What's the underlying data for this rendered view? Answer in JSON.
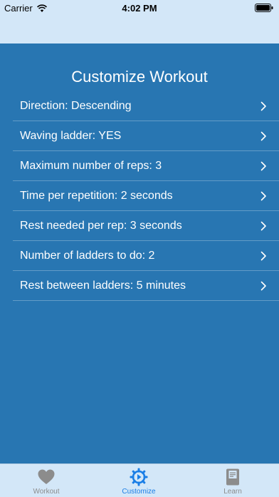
{
  "status_bar": {
    "carrier": "Carrier",
    "time": "4:02 PM"
  },
  "main": {
    "title": "Customize Workout",
    "settings": [
      {
        "label": "Direction: Descending"
      },
      {
        "label": "Waving ladder: YES"
      },
      {
        "label": "Maximum number of reps: 3"
      },
      {
        "label": "Time per repetition: 2 seconds"
      },
      {
        "label": "Rest needed per rep: 3 seconds"
      },
      {
        "label": "Number of ladders to do: 2"
      },
      {
        "label": "Rest between ladders: 5 minutes"
      }
    ]
  },
  "tab_bar": {
    "tabs": [
      {
        "label": "Workout",
        "icon": "heart-icon",
        "active": false
      },
      {
        "label": "Customize",
        "icon": "gear-icon",
        "active": true
      },
      {
        "label": "Learn",
        "icon": "book-icon",
        "active": false
      }
    ]
  },
  "colors": {
    "background": "#d3e7f8",
    "panel": "#2876b2",
    "active_tab": "#1a7ee6",
    "inactive_tab": "#8c8c8c"
  }
}
